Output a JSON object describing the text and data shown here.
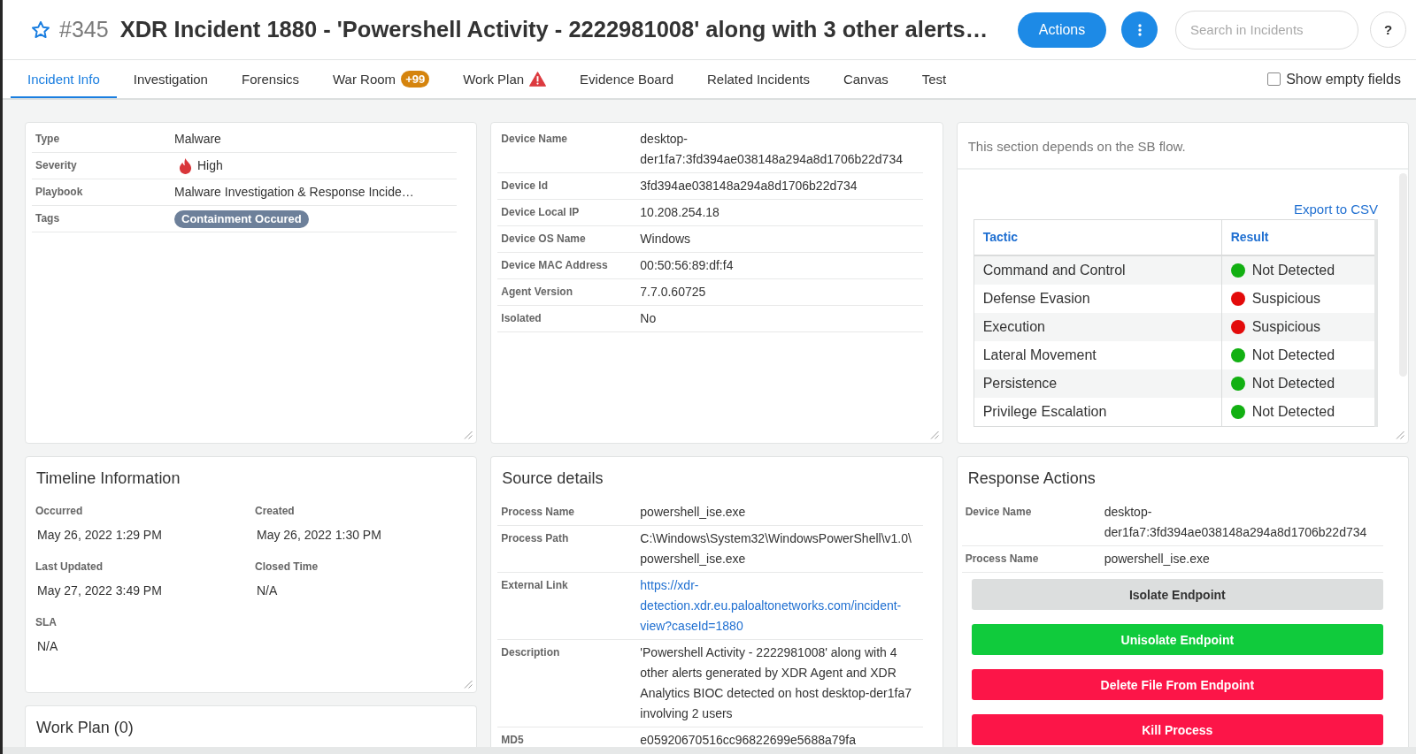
{
  "header": {
    "starred": false,
    "number": "#345",
    "title": "XDR Incident 1880 - 'Powershell Activity - 2222981008' along with 3 other alerts…",
    "actions_button": "Actions",
    "search": {
      "placeholder": "Search in Incidents"
    },
    "help_button": "?"
  },
  "tabs": [
    {
      "label": "Incident Info",
      "selected": true,
      "warning": false
    },
    {
      "label": "Investigation",
      "selected": false,
      "warning": false
    },
    {
      "label": "Forensics",
      "selected": false,
      "warning": false
    },
    {
      "label": "War Room",
      "selected": false,
      "warning": false,
      "badge": "+99"
    },
    {
      "label": "Work Plan",
      "selected": false,
      "warning": true
    },
    {
      "label": "Evidence Board",
      "selected": false,
      "warning": false
    },
    {
      "label": "Related Incidents",
      "selected": false,
      "warning": false
    },
    {
      "label": "Canvas",
      "selected": false,
      "warning": false
    },
    {
      "label": "Test",
      "selected": false,
      "warning": false
    }
  ],
  "show_empty_fields": {
    "label": "Show empty fields",
    "checked": false
  },
  "summary_panel": {
    "fields": [
      {
        "kind": "text",
        "label": "Type",
        "value": "Malware"
      },
      {
        "kind": "severity",
        "label": "Severity",
        "value": "High"
      },
      {
        "kind": "text",
        "label": "Playbook",
        "value": "Malware Investigation & Response Incide…"
      },
      {
        "kind": "tags",
        "label": "Tags",
        "tags": [
          "Containment Occured"
        ]
      }
    ]
  },
  "device_panel": {
    "fields": [
      {
        "label": "Device Name",
        "value": "desktop-der1fa7:3fd394ae038148a294a8d1706b22d734"
      },
      {
        "label": "Device Id",
        "value": "3fd394ae038148a294a8d1706b22d734"
      },
      {
        "label": "Device Local IP",
        "value": "10.208.254.18"
      },
      {
        "label": "Device OS Name",
        "value": "Windows"
      },
      {
        "label": "Device MAC Address",
        "value": "00:50:56:89:df:f4"
      },
      {
        "label": "Agent Version",
        "value": "7.7.0.60725"
      },
      {
        "label": "Isolated",
        "value": "No"
      }
    ]
  },
  "tactics_panel": {
    "note": "This section depends on the SB flow.",
    "export_link": "Export to CSV",
    "columns": [
      "Tactic",
      "Result"
    ],
    "rows": [
      {
        "tactic": "Command and Control",
        "result": "Not Detected",
        "color": "#12b012"
      },
      {
        "tactic": "Defense Evasion",
        "result": "Suspicious",
        "color": "#e30b0b"
      },
      {
        "tactic": "Execution",
        "result": "Suspicious",
        "color": "#e30b0b"
      },
      {
        "tactic": "Lateral Movement",
        "result": "Not Detected",
        "color": "#12b012"
      },
      {
        "tactic": "Persistence",
        "result": "Not Detected",
        "color": "#12b012"
      },
      {
        "tactic": "Privilege Escalation",
        "result": "Not Detected",
        "color": "#12b012"
      }
    ]
  },
  "timeline_panel": {
    "title": "Timeline Information",
    "fields": [
      {
        "label": "Occurred",
        "value": "May 26, 2022 1:29 PM"
      },
      {
        "label": "Created",
        "value": "May 26, 2022 1:30 PM"
      },
      {
        "label": "Last Updated",
        "value": "May 27, 2022 3:49 PM"
      },
      {
        "label": "Closed Time",
        "value": "N/A"
      },
      {
        "label": "SLA",
        "value": "N/A"
      }
    ]
  },
  "work_plan_panel": {
    "title": "Work Plan (0)"
  },
  "source_panel": {
    "title": "Source details",
    "fields": [
      {
        "kind": "text",
        "label": "Process Name",
        "value": "powershell_ise.exe"
      },
      {
        "kind": "text",
        "label": "Process Path",
        "value": "C:\\Windows\\System32\\WindowsPowerShell\\v1.0\\powershell_ise.exe"
      },
      {
        "kind": "link",
        "label": "External Link",
        "value": "https://xdr-detection.xdr.eu.paloaltonetworks.com/incident-view?caseId=1880"
      },
      {
        "kind": "text",
        "label": "Description",
        "value": "'Powershell Activity - 2222981008' along with 4 other alerts generated by XDR Agent and XDR Analytics BIOC detected on host desktop-der1fa7 involving 2 users"
      },
      {
        "kind": "text",
        "label": "MD5",
        "value": "e05920670516cc96822699e5688a79fa"
      }
    ]
  },
  "response_panel": {
    "title": "Response Actions",
    "fields": [
      {
        "label": "Device Name",
        "value": "desktop-der1fa7:3fd394ae038148a294a8d1706b22d734"
      },
      {
        "label": "Process Name",
        "value": "powershell_ise.exe"
      }
    ],
    "buttons": [
      {
        "label": "Isolate Endpoint",
        "kind": "neutral"
      },
      {
        "label": "Unisolate Endpoint",
        "kind": "success"
      },
      {
        "label": "Delete File From Endpoint",
        "kind": "danger"
      },
      {
        "label": "Kill Process",
        "kind": "danger"
      }
    ]
  }
}
